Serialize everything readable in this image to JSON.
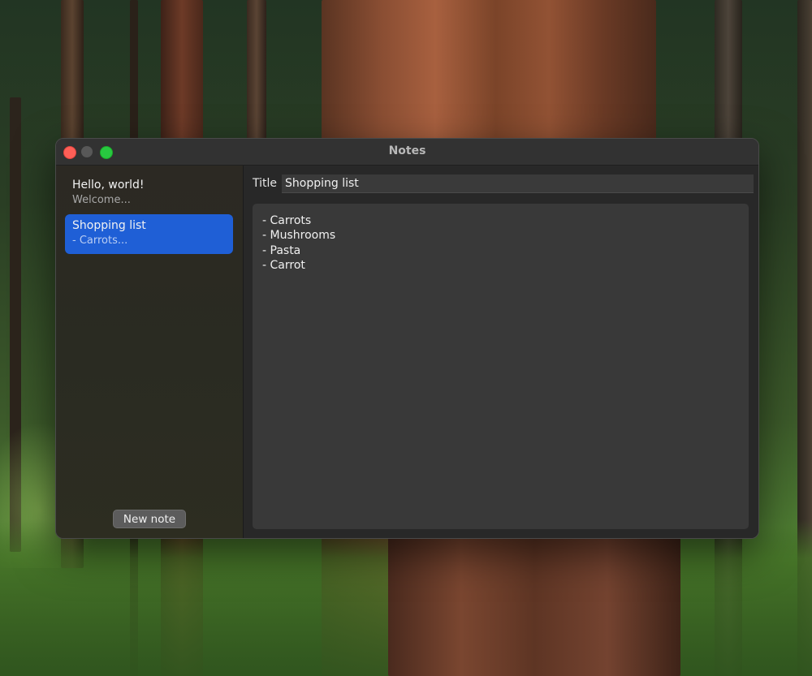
{
  "window": {
    "title": "Notes"
  },
  "notes": [
    {
      "title": "Hello, world!",
      "preview": "Welcome..."
    },
    {
      "title": "Shopping list",
      "preview": "- Carrots..."
    }
  ],
  "sidebar": {
    "new_note_label": "New note"
  },
  "editor": {
    "title_label": "Title",
    "title_value": "Shopping list",
    "body_lines": [
      "- Carrots",
      "- Mushrooms",
      "- Pasta",
      "- Carrot"
    ]
  },
  "colors": {
    "selection": "#1f5fd6",
    "close": "#fe5f57",
    "minimize": "#585858",
    "maximize": "#28c840"
  },
  "icons": [
    "close-window-icon",
    "minimize-window-icon",
    "maximize-window-icon"
  ]
}
